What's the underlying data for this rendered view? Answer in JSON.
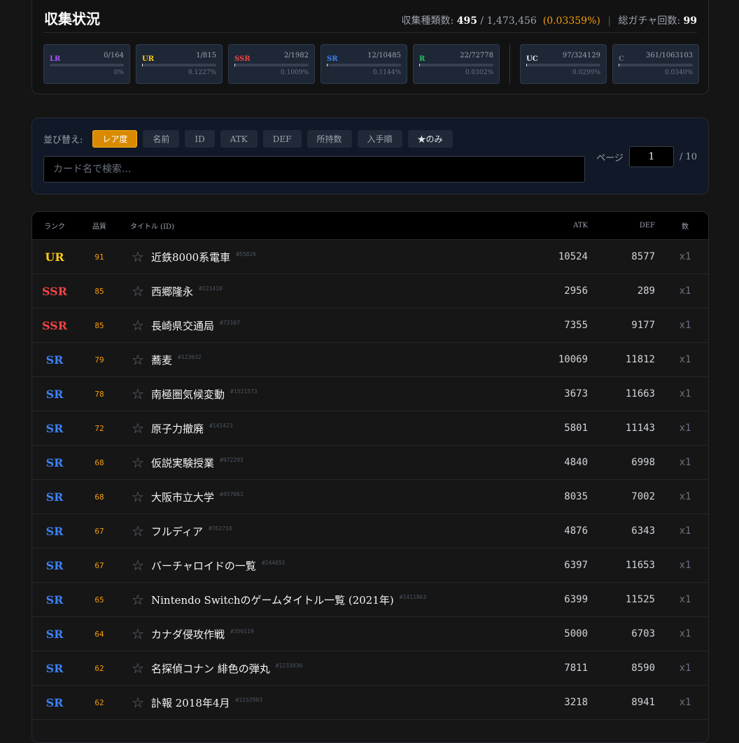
{
  "stats": {
    "title": "収集状況",
    "collected_label": "収集種類数:",
    "collected": "495",
    "total": "/ 1,473,456",
    "percent": "(0.03359%)",
    "separator": "|",
    "gacha_label": "総ガチャ回数:",
    "gacha_count": "99",
    "cards": [
      {
        "rarity": "LR",
        "count": "0/164",
        "percent": "0%",
        "progress": 0,
        "color": "#a855f7"
      },
      {
        "rarity": "UR",
        "count": "1/815",
        "percent": "0.1227%",
        "progress": 0.001227,
        "color": "#facc15"
      },
      {
        "rarity": "SSR",
        "count": "2/1982",
        "percent": "0.1009%",
        "progress": 0.001009,
        "color": "#ef4444"
      },
      {
        "rarity": "SR",
        "count": "12/10485",
        "percent": "0.1144%",
        "progress": 0.001144,
        "color": "#3b82f6"
      },
      {
        "rarity": "R",
        "count": "22/72778",
        "percent": "0.0302%",
        "progress": 0.000302,
        "color": "#22c55e"
      },
      {
        "rarity": "UC",
        "count": "97/324129",
        "percent": "0.0299%",
        "progress": 0.000299,
        "color": "#e5e7eb"
      },
      {
        "rarity": "C",
        "count": "361/1063103",
        "percent": "0.0340%",
        "progress": 0.00034,
        "color": "#6b7280"
      }
    ]
  },
  "filter": {
    "sort_label": "並び替え:",
    "sort_buttons": [
      "レア度",
      "名前",
      "ID",
      "ATK",
      "DEF",
      "所持数",
      "入手順"
    ],
    "favorites_button": "★のみ",
    "search_placeholder": "カード名で検索...",
    "page_label": "ページ",
    "page_value": "1",
    "page_total": "/ 10"
  },
  "table": {
    "headers": {
      "rank": "ランク",
      "quality": "品質",
      "title": "タイトル (ID)",
      "atk": "ATK",
      "def": "DEF",
      "count": "数"
    },
    "rows": [
      {
        "rank": "UR",
        "quality": "91",
        "title": "近鉄8000系電車",
        "id": "#55826",
        "atk": "10524",
        "def": "8577",
        "count": "x1"
      },
      {
        "rank": "SSR",
        "quality": "85",
        "title": "西郷隆永",
        "id": "#221410",
        "atk": "2956",
        "def": "289",
        "count": "x1"
      },
      {
        "rank": "SSR",
        "quality": "85",
        "title": "長崎県交通局",
        "id": "#73107",
        "atk": "7355",
        "def": "9177",
        "count": "x1"
      },
      {
        "rank": "SR",
        "quality": "79",
        "title": "蕎麦",
        "id": "#123632",
        "atk": "10069",
        "def": "11812",
        "count": "x1"
      },
      {
        "rank": "SR",
        "quality": "78",
        "title": "南極圏気候変動",
        "id": "#1521573",
        "atk": "3673",
        "def": "11663",
        "count": "x1"
      },
      {
        "rank": "SR",
        "quality": "72",
        "title": "原子力撤廃",
        "id": "#141423",
        "atk": "5801",
        "def": "11143",
        "count": "x1"
      },
      {
        "rank": "SR",
        "quality": "68",
        "title": "仮説実験授業",
        "id": "#972293",
        "atk": "4840",
        "def": "6998",
        "count": "x1"
      },
      {
        "rank": "SR",
        "quality": "68",
        "title": "大阪市立大学",
        "id": "#457063",
        "atk": "8035",
        "def": "7002",
        "count": "x1"
      },
      {
        "rank": "SR",
        "quality": "67",
        "title": "フルディア",
        "id": "#762710",
        "atk": "4876",
        "def": "6343",
        "count": "x1"
      },
      {
        "rank": "SR",
        "quality": "67",
        "title": "バーチャロイドの一覧",
        "id": "#244651",
        "atk": "6397",
        "def": "11653",
        "count": "x1"
      },
      {
        "rank": "SR",
        "quality": "65",
        "title": "Nintendo Switchのゲームタイトル一覧 (2021年)",
        "id": "#1411863",
        "atk": "6399",
        "def": "11525",
        "count": "x1"
      },
      {
        "rank": "SR",
        "quality": "64",
        "title": "カナダ侵攻作戦",
        "id": "#356119",
        "atk": "5000",
        "def": "6703",
        "count": "x1"
      },
      {
        "rank": "SR",
        "quality": "62",
        "title": "名探偵コナン 緋色の弾丸",
        "id": "#1233036",
        "atk": "7811",
        "def": "8590",
        "count": "x1"
      },
      {
        "rank": "SR",
        "quality": "62",
        "title": "訃報 2018年4月",
        "id": "#1152903",
        "atk": "3218",
        "def": "8941",
        "count": "x1"
      }
    ]
  },
  "rank_colors": {
    "LR": "#a855f7",
    "UR": "#facc15",
    "SSR": "#ef4444",
    "SR": "#3b82f6",
    "R": "#22c55e",
    "UC": "#e5e7eb",
    "C": "#6b7280"
  },
  "icons": {
    "favorite": "star-outline-icon"
  }
}
